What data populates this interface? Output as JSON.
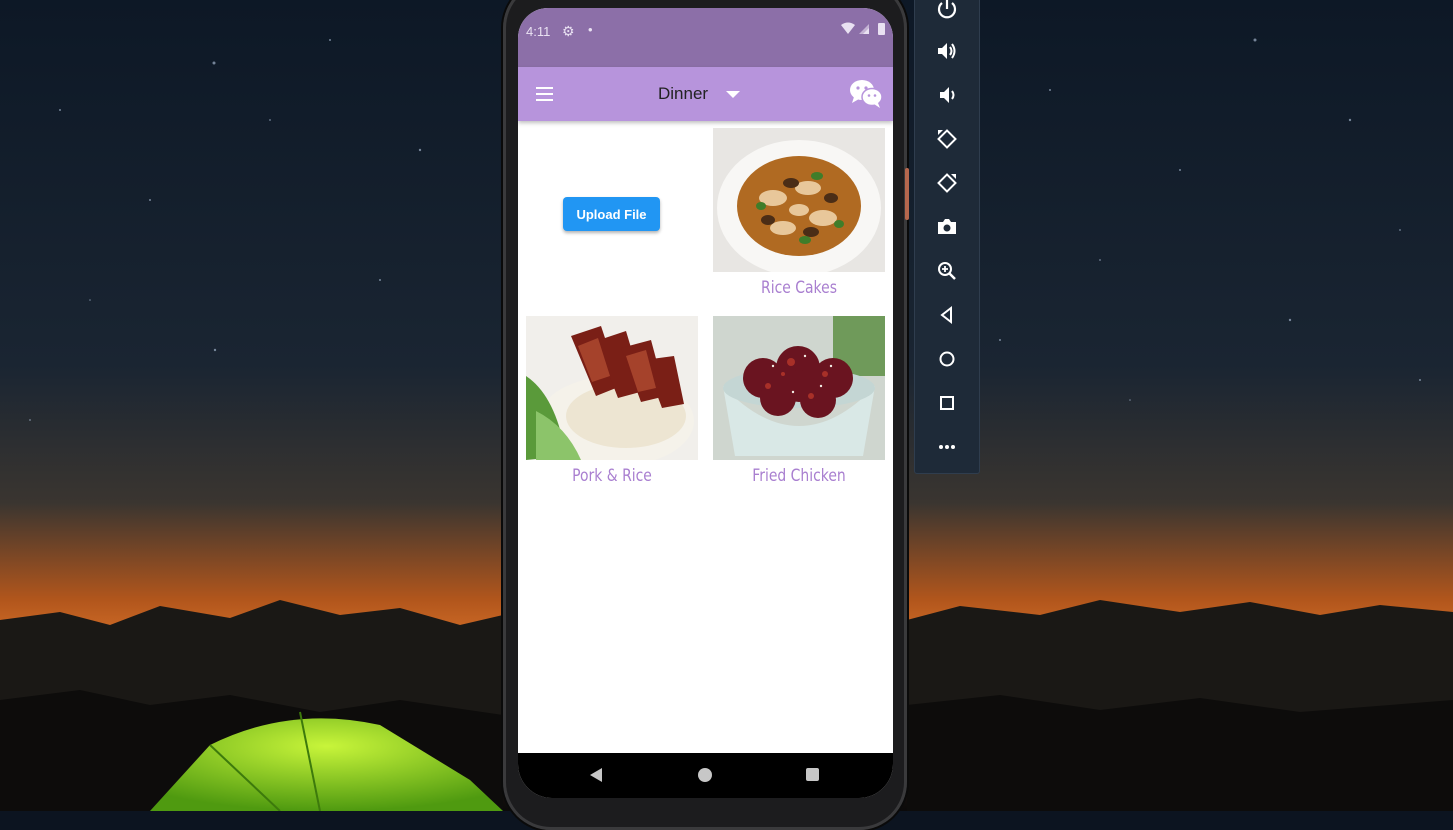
{
  "status_bar": {
    "time": "4:11",
    "icons": [
      "settings-icon",
      "notification-dot-icon",
      "wifi-icon",
      "signal-icon",
      "battery-icon"
    ]
  },
  "app_bar": {
    "menu_icon": "hamburger-menu-icon",
    "selected_meal": "Dinner",
    "action_icon": "wechat-icon",
    "colors": {
      "app_bar": "#b794dc",
      "status_bar": "#8c6fa8"
    }
  },
  "main": {
    "upload_button_label": "Upload File",
    "upload_button_color": "#2196f3",
    "foods": [
      {
        "name": "Rice Cakes"
      },
      {
        "name": "Pork & Rice"
      },
      {
        "name": "Fried Chicken"
      }
    ],
    "label_color": "#a97fd0"
  },
  "nav_bar": {
    "icons": [
      "back-icon",
      "home-icon",
      "recents-icon"
    ]
  },
  "emulator_toolbar": {
    "buttons": [
      "power-icon",
      "volume-up-icon",
      "volume-down-icon",
      "rotate-left-icon",
      "rotate-right-icon",
      "camera-icon",
      "zoom-icon",
      "back-icon",
      "home-icon",
      "overview-icon",
      "more-icon"
    ]
  }
}
